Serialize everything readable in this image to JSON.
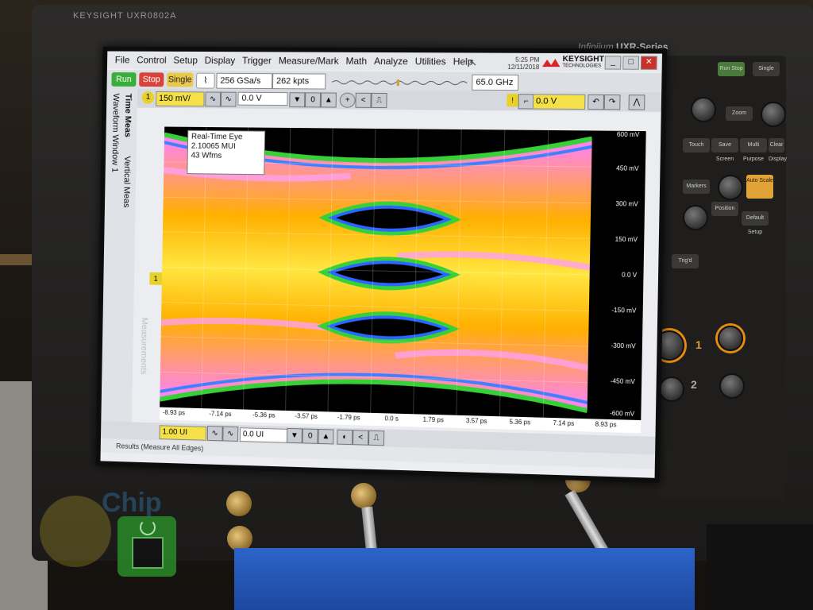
{
  "chassis": {
    "brand_top": "KEYSIGHT   UXR0802A",
    "infiniium": "Infiniium",
    "series": "UXR-Series"
  },
  "menu": [
    "File",
    "Control",
    "Setup",
    "Display",
    "Trigger",
    "Measure/Mark",
    "Math",
    "Analyze",
    "Utilities",
    "Help"
  ],
  "status": {
    "time": "5:25 PM",
    "date": "12/11/2018",
    "brand": "KEYSIGHT",
    "brand_sub": "TECHNOLOGIES"
  },
  "toolbar": {
    "run": "Run",
    "stop": "Stop",
    "single": "Single",
    "sample_rate": "256 GSa/s",
    "memory_depth": "262 kpts",
    "bandwidth": "65.0 GHz"
  },
  "channel": {
    "number": "1",
    "scale": "150 mV/",
    "offset": "0.0 V"
  },
  "trigger": {
    "level": "0.0 V"
  },
  "side_tabs": {
    "time_meas": "Time Meas",
    "vertical_meas": "Vertical Meas",
    "waveform_window": "Waveform Window 1",
    "measurements": "Measurements"
  },
  "eye_info": {
    "line1": "Real-Time Eye",
    "line2": "2.10065 MUI",
    "line3": "43 Wfms"
  },
  "y_labels": [
    "600 mV",
    "450 mV",
    "300 mV",
    "150 mV",
    "0.0 V",
    "-150 mV",
    "-300 mV",
    "-450 mV",
    "-600 mV"
  ],
  "x_labels": [
    "-8.93 ps",
    "-7.14 ps",
    "-5.36 ps",
    "-3.57 ps",
    "-1.79 ps",
    "0.0 s",
    "1.79 ps",
    "3.57 ps",
    "5.36 ps",
    "7.14 ps",
    "8.93 ps"
  ],
  "x_scale": "1.00 UI",
  "x_offset": "0.0 UI",
  "bottom_status": "Results (Measure All Edges)",
  "side_label_right": "Infiniium",
  "hardware": {
    "ch1_label": "1",
    "ch2_label": "2",
    "buttons": [
      "Run Stop",
      "Single",
      "Zoom",
      "Touch",
      "Save Screen",
      "Multi Purpose",
      "Clear Display",
      "Markers",
      "Auto Scale",
      "Position",
      "Default Setup",
      "Trig'd"
    ]
  },
  "colors": {
    "run": "#3aae3a",
    "stop": "#d8423a",
    "single": "#e9c84a",
    "channel": "#f4e14a"
  }
}
